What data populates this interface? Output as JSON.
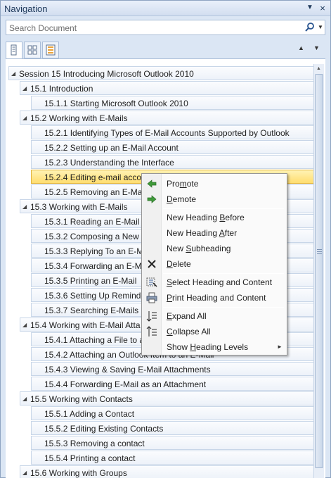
{
  "pane": {
    "title": "Navigation",
    "menu_glyph": "▼",
    "close_glyph": "×"
  },
  "search": {
    "placeholder": "Search Document",
    "icon": "magnifier-icon",
    "dropdown_glyph": "▼"
  },
  "view_tabs": [
    {
      "name": "headings-tab",
      "icon": "document-headings-icon",
      "active": true
    },
    {
      "name": "pages-tab",
      "icon": "thumbnails-icon",
      "active": false
    },
    {
      "name": "results-tab",
      "icon": "results-list-icon",
      "active": false
    }
  ],
  "nav_buttons": {
    "previous": "▲",
    "next": "▼"
  },
  "tree": {
    "expand_glyph": "◢",
    "items": [
      {
        "level": 0,
        "text": "Session 15  Introducing Microsoft Outlook 2010",
        "expander": true,
        "selected": false
      },
      {
        "level": 1,
        "text": "15.1 Introduction",
        "expander": true,
        "selected": false
      },
      {
        "level": 2,
        "text": "15.1.1  Starting Microsoft Outlook 2010",
        "expander": false,
        "selected": false
      },
      {
        "level": 1,
        "text": "15.2 Working with E-Mails",
        "expander": true,
        "selected": false
      },
      {
        "level": 2,
        "text": "15.2.1  Identifying Types of E-Mail Accounts Supported by Outlook",
        "expander": false,
        "selected": false
      },
      {
        "level": 2,
        "text": "15.2.2  Setting up an E-Mail Account",
        "expander": false,
        "selected": false
      },
      {
        "level": 2,
        "text": "15.2.3  Understanding the Interface",
        "expander": false,
        "selected": false
      },
      {
        "level": 2,
        "text": "15.2.4  Editing e-mail accou",
        "expander": false,
        "selected": true
      },
      {
        "level": 2,
        "text": "15.2.5  Removing an E-Mail",
        "expander": false,
        "selected": false
      },
      {
        "level": 1,
        "text": "15.3 Working with E-Mails",
        "expander": true,
        "selected": false
      },
      {
        "level": 2,
        "text": "15.3.1  Reading an E-Mail",
        "expander": false,
        "selected": false
      },
      {
        "level": 2,
        "text": "15.3.2  Composing a New E",
        "expander": false,
        "selected": false
      },
      {
        "level": 2,
        "text": "15.3.3  Replying To an E-Ma",
        "expander": false,
        "selected": false
      },
      {
        "level": 2,
        "text": "15.3.4  Forwarding an E-Ma",
        "expander": false,
        "selected": false
      },
      {
        "level": 2,
        "text": "15.3.5  Printing an E-Mail",
        "expander": false,
        "selected": false
      },
      {
        "level": 2,
        "text": "15.3.6  Setting Up Reminde",
        "expander": false,
        "selected": false
      },
      {
        "level": 2,
        "text": "15.3.7  Searching E-Mails",
        "expander": false,
        "selected": false
      },
      {
        "level": 1,
        "text": "15.4 Working with E-Mail Atta",
        "expander": true,
        "selected": false
      },
      {
        "level": 2,
        "text": "15.4.1  Attaching a File to a",
        "expander": false,
        "selected": false
      },
      {
        "level": 2,
        "text": "15.4.2  Attaching an Outlook Item to an E-Mail",
        "expander": false,
        "selected": false
      },
      {
        "level": 2,
        "text": "15.4.3  Viewing & Saving E-Mail Attachments",
        "expander": false,
        "selected": false
      },
      {
        "level": 2,
        "text": "15.4.4  Forwarding E-Mail as an Attachment",
        "expander": false,
        "selected": false
      },
      {
        "level": 1,
        "text": "15.5 Working with Contacts",
        "expander": true,
        "selected": false
      },
      {
        "level": 2,
        "text": "15.5.1  Adding a Contact",
        "expander": false,
        "selected": false
      },
      {
        "level": 2,
        "text": "15.5.2  Editing Existing Contacts",
        "expander": false,
        "selected": false
      },
      {
        "level": 2,
        "text": "15.5.3  Removing a contact",
        "expander": false,
        "selected": false
      },
      {
        "level": 2,
        "text": "15.5.4  Printing a contact",
        "expander": false,
        "selected": false
      },
      {
        "level": 1,
        "text": "15.6 Working with Groups",
        "expander": true,
        "selected": false
      }
    ]
  },
  "scrollbar": {
    "up_glyph": "▲"
  },
  "context_menu": {
    "items": [
      {
        "label": "Promote",
        "icon": "promote-arrow-icon"
      },
      {
        "label": "Demote",
        "icon": "demote-arrow-icon"
      },
      {
        "separator": true
      },
      {
        "label": "New Heading Before",
        "icon": ""
      },
      {
        "label": "New Heading After",
        "icon": ""
      },
      {
        "label": "New Subheading",
        "icon": ""
      },
      {
        "label": "Delete",
        "icon": "delete-x-icon"
      },
      {
        "separator": true
      },
      {
        "label": "Select Heading and Content",
        "icon": "select-content-icon"
      },
      {
        "label": "Print Heading and Content",
        "icon": "printer-icon"
      },
      {
        "separator": true
      },
      {
        "label": "Expand All",
        "icon": "expand-all-icon"
      },
      {
        "label": "Collapse All",
        "icon": "collapse-all-icon"
      },
      {
        "label": "Show Heading Levels",
        "icon": "",
        "submenu": true,
        "submenu_glyph": "►"
      }
    ]
  }
}
